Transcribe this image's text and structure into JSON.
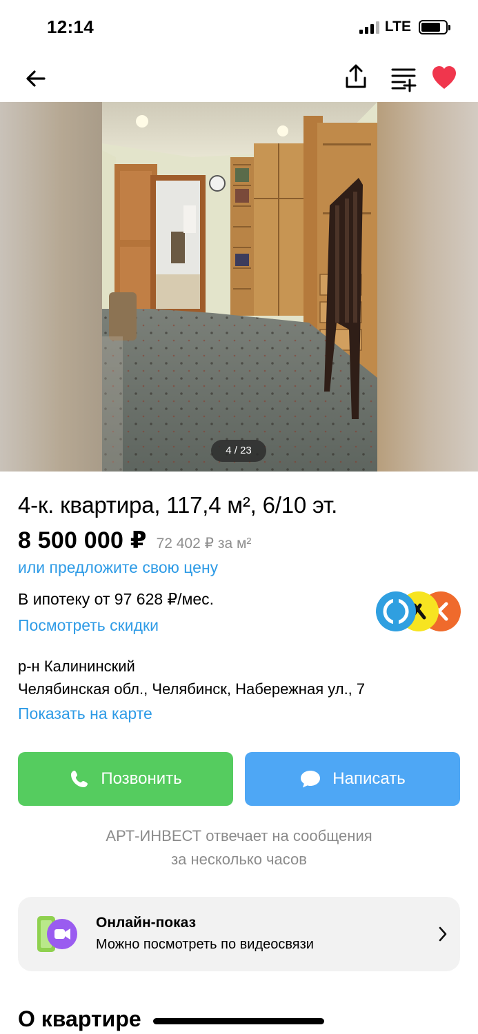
{
  "status_bar": {
    "time": "12:14",
    "network": "LTE",
    "battery_level": 0.8
  },
  "nav": {
    "back_icon": "arrow-left-icon",
    "share_icon": "share-icon",
    "compare_icon": "compare-list-icon",
    "favorite_icon": "heart-filled-icon",
    "favorite_color": "#f0364d"
  },
  "gallery": {
    "counter": "4 / 23",
    "current": 4,
    "total": 23
  },
  "listing": {
    "title": "4-к. квартира, 117,4 м², 6/10 эт.",
    "price": "8 500 000 ₽",
    "price_per_sqm": "72 402 ₽ за м²",
    "offer_link": "или предложите свою цену",
    "mortgage": "В ипотеку от 97 628 ₽/мес.",
    "discount_link": "Посмотреть скидки",
    "district": "р-н Калининский",
    "address": "Челябинская обл., Челябинск, Набережная ул., 7",
    "map_link": "Показать на карте"
  },
  "actions": {
    "call_label": "Позвонить",
    "call_icon": "phone-icon",
    "call_color": "#55cc5f",
    "write_label": "Написать",
    "write_icon": "chat-bubble-icon",
    "write_color": "#4ea7f5"
  },
  "reply_note": {
    "line1": "АРТ-ИНВЕСТ отвечает на сообщения",
    "line2": "за несколько часов"
  },
  "online_showing": {
    "title": "Онлайн-показ",
    "subtitle": "Можно посмотреть по видеосвязи",
    "icon": "video-call-icon"
  },
  "section": {
    "title": "О квартире"
  },
  "colors": {
    "link": "#2e9be6",
    "muted": "#8b8b8b"
  }
}
